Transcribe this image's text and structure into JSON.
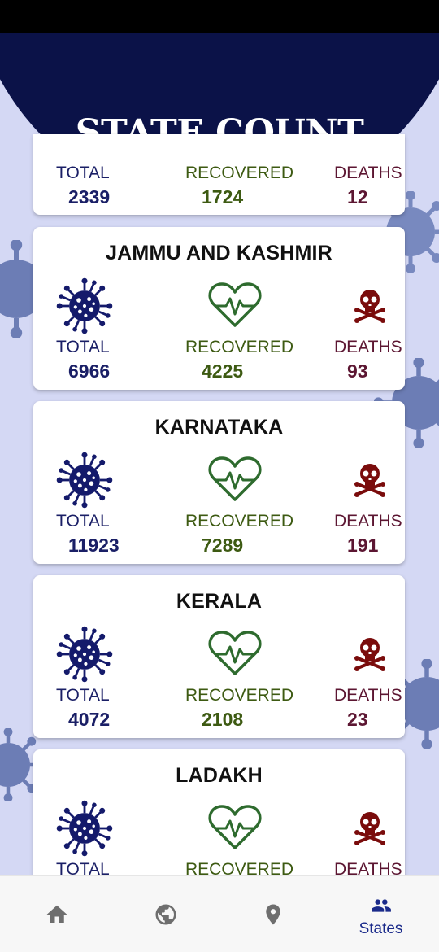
{
  "page_title": "STATE COUNT",
  "labels": {
    "total": "TOTAL",
    "recovered": "RECOVERED",
    "deaths": "DEATHS"
  },
  "states": [
    {
      "name": "",
      "total": "2339",
      "recovered": "1724",
      "deaths": "12"
    },
    {
      "name": "JAMMU AND KASHMIR",
      "total": "6966",
      "recovered": "4225",
      "deaths": "93"
    },
    {
      "name": "KARNATAKA",
      "total": "11923",
      "recovered": "7289",
      "deaths": "191"
    },
    {
      "name": "KERALA",
      "total": "4072",
      "recovered": "2108",
      "deaths": "23"
    },
    {
      "name": "LADAKH",
      "total": "",
      "recovered": "",
      "deaths": ""
    }
  ],
  "nav": [
    {
      "icon": "home-icon",
      "label": ""
    },
    {
      "icon": "globe-icon",
      "label": ""
    },
    {
      "icon": "location-pin-icon",
      "label": ""
    },
    {
      "icon": "people-icon",
      "label": "States"
    }
  ],
  "colors": {
    "header": "#0b1248",
    "background": "#d4d8f4",
    "total": "#1a1f66",
    "recovered": "#3d5a12",
    "deaths": "#5c1632",
    "nav_active": "#1a2a8a",
    "nav_inactive": "#6e6e6e"
  }
}
